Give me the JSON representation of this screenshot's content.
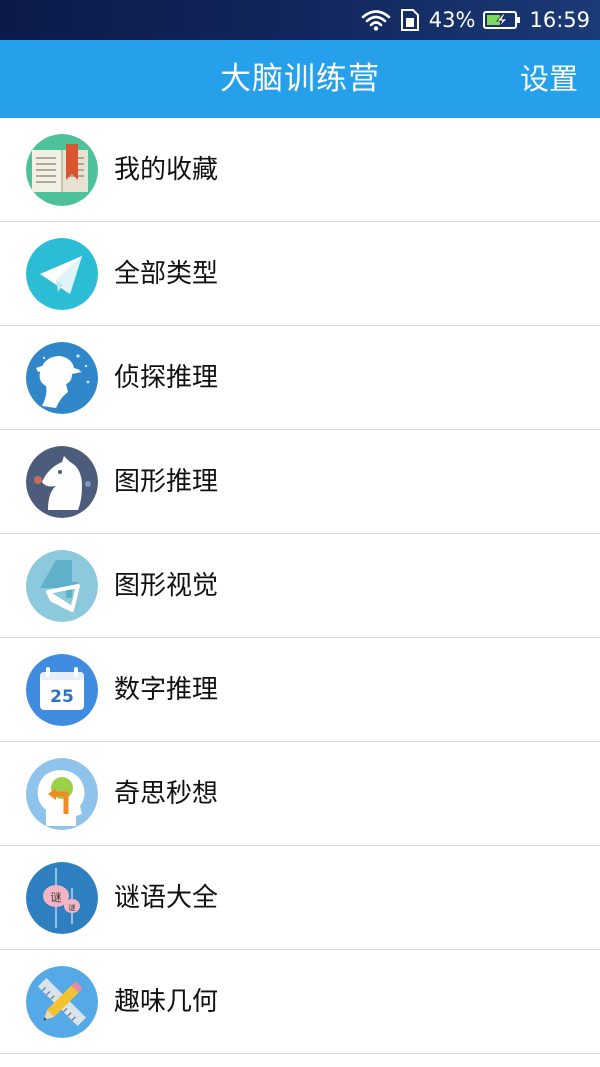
{
  "status_bar": {
    "battery_percent": "43%",
    "time": "16:59",
    "icons": [
      "wifi-icon",
      "sim-icon",
      "battery-charging-icon"
    ]
  },
  "app_bar": {
    "title": "大脑训练营",
    "settings_label": "设置"
  },
  "colors": {
    "app_bar": "#26a0ea",
    "status_bar": "#12265c",
    "divider": "#d9d9d9"
  },
  "menu": {
    "items": [
      {
        "label": "我的收藏",
        "icon": "bookmark-book-icon"
      },
      {
        "label": "全部类型",
        "icon": "paper-plane-icon"
      },
      {
        "label": "侦探推理",
        "icon": "detective-icon"
      },
      {
        "label": "图形推理",
        "icon": "chess-knight-icon"
      },
      {
        "label": "图形视觉",
        "icon": "number-four-icon"
      },
      {
        "label": "数字推理",
        "icon": "calendar-25-icon"
      },
      {
        "label": "奇思秒想",
        "icon": "head-idea-icon"
      },
      {
        "label": "谜语大全",
        "icon": "lantern-riddle-icon"
      },
      {
        "label": "趣味几何",
        "icon": "ruler-pencil-icon"
      }
    ]
  }
}
